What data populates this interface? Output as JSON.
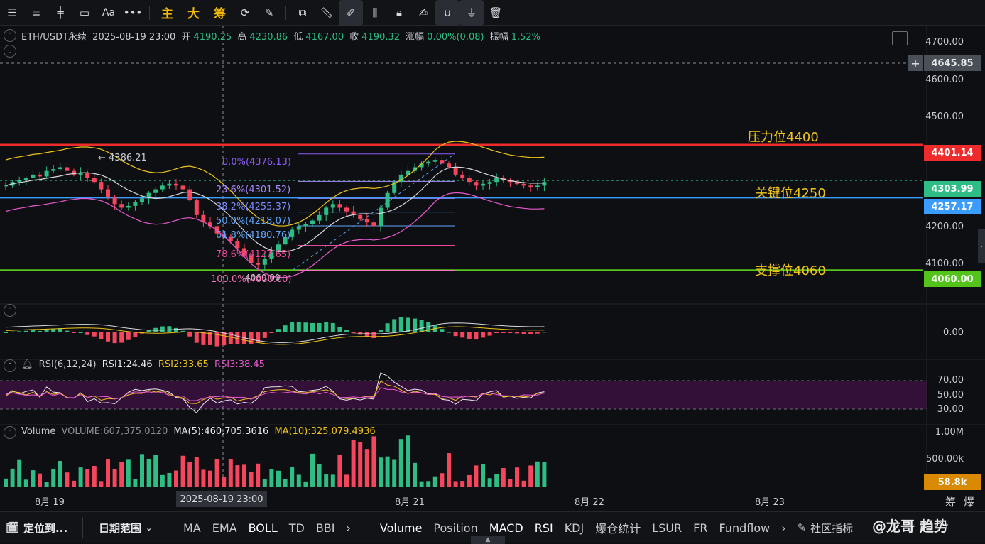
{
  "toolbar": {
    "main_label": "主",
    "big_label": "大",
    "chips_label": "筹"
  },
  "legend": {
    "symbol": "ETH/USDT永续",
    "datetime": "2025-08-19 23:00",
    "open_label": "开",
    "open": "4190.25",
    "high_label": "高",
    "high": "4230.86",
    "low_label": "低",
    "low": "4167.00",
    "close_label": "收",
    "close": "4190.32",
    "change_label": "涨幅",
    "change": "0.00%(0.08)",
    "amp_label": "振幅",
    "amp": "1.52%"
  },
  "price_axis": [
    "4700.00",
    "4600.00",
    "4500.00",
    "4400.00",
    "4300.00",
    "4200.00",
    "4100.00"
  ],
  "price_tags": {
    "crosshair": "4645.85",
    "resistance": "4401.14",
    "current": "4303.99",
    "key": "4257.17",
    "support": "4060.00"
  },
  "annotations": {
    "resistance": "压力位4400",
    "key": "关键位4250",
    "support": "支撑位4060",
    "high_marker": "← 4386.21",
    "low_marker": "4060.00"
  },
  "fib_levels": [
    {
      "label": "0.0%(4376.13)",
      "color": "#8b5cf6"
    },
    {
      "label": "23.6%(4301.52)",
      "color": "#a78bfa"
    },
    {
      "label": "38.2%(4255.37)",
      "color": "#7c8cff"
    },
    {
      "label": "50.0%(4218.07)",
      "color": "#60a5fa"
    },
    {
      "label": "61.8%(4180.76)",
      "color": "#60a5fa"
    },
    {
      "label": "78.6%(4127.65)",
      "color": "#ec4899"
    },
    {
      "label": "100.0%(4060.00)",
      "color": "#f472b6"
    }
  ],
  "macd": {
    "zero": "0.00"
  },
  "rsi": {
    "title": "RSI(6,12,24)",
    "rsi1": "RSI1:24.46",
    "rsi2": "RSI2:33.65",
    "rsi3": "RSI3:38.45",
    "levels": [
      "70.00",
      "50.00",
      "30.00"
    ]
  },
  "volume": {
    "title": "Volume",
    "value": "VOLUME:607,375.0120",
    "ma5": "MA(5):460,705.3616",
    "ma10": "MA(10):325,079.4936",
    "axis": [
      "1.00M",
      "500.00k"
    ],
    "current_tag": "58.8k"
  },
  "dates": {
    "d19": "8月 19",
    "crosshair": "2025-08-19 23:00",
    "d21": "8月 21",
    "d22": "8月 22",
    "d23": "8月 23"
  },
  "right_corner": {
    "chips": "筹",
    "liq": "爆"
  },
  "bottombar": {
    "locate": "定位到...",
    "range": "日期范围",
    "indicators_main": [
      "MA",
      "EMA",
      "BOLL",
      "TD",
      "BBI"
    ],
    "indicators_sub": [
      "Volume",
      "Position",
      "MACD",
      "RSI",
      "KDJ",
      "爆仓统计",
      "LSUR",
      "FR",
      "Fundflow"
    ],
    "community": "社区指标",
    "watermark": "@龙哥 趋势"
  },
  "colors": {
    "up": "#2ebd85",
    "down": "#f6465d",
    "resistance": "#ef2b2b",
    "key": "#3b9cff",
    "support": "#52c41a",
    "accent": "#f0b90b"
  }
}
